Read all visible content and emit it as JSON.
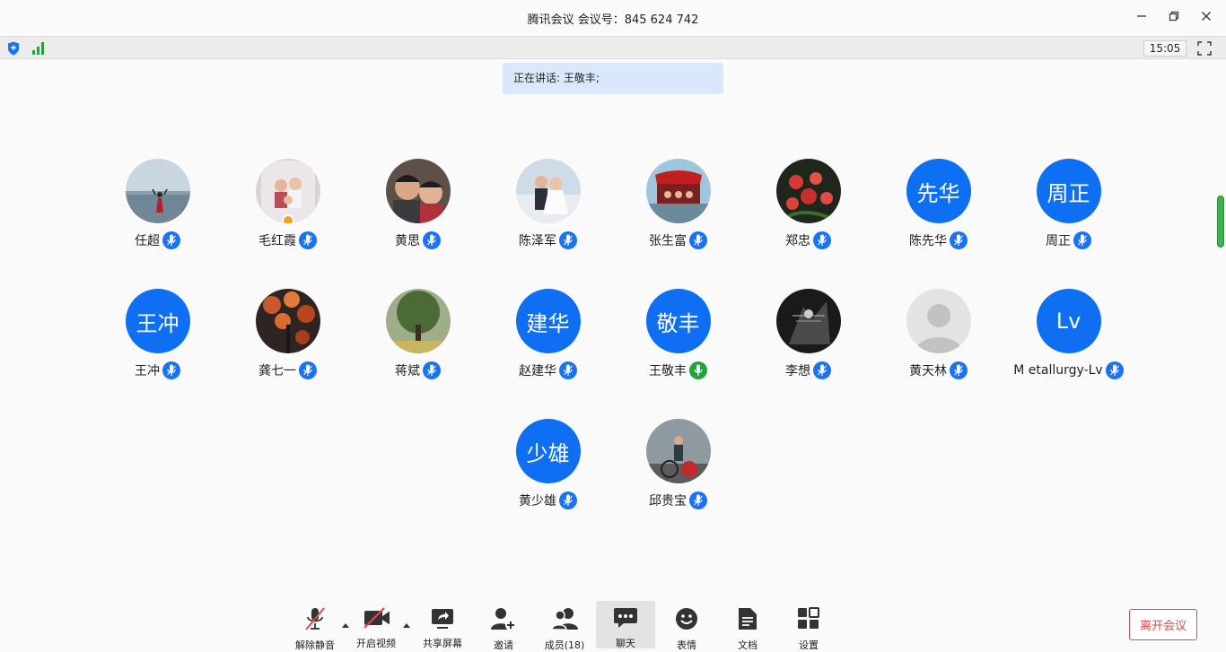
{
  "window": {
    "title": "腾讯会议 会议号：845 624 742"
  },
  "status": {
    "clock": "15:05"
  },
  "speaking_banner": "正在讲话: 王敬丰;",
  "members": [
    {
      "name": "任超",
      "avatar": "photo-seaside",
      "mic": "muted"
    },
    {
      "name": "毛红霞",
      "avatar": "photo-family",
      "mic": "muted",
      "host": true
    },
    {
      "name": "黄思",
      "avatar": "photo-selfie",
      "mic": "muted"
    },
    {
      "name": "陈泽军",
      "avatar": "photo-wedding",
      "mic": "muted"
    },
    {
      "name": "张生富",
      "avatar": "photo-boat",
      "mic": "muted"
    },
    {
      "name": "郑忠",
      "avatar": "photo-roses",
      "mic": "muted"
    },
    {
      "name": "陈先华",
      "initials": "先华",
      "mic": "muted"
    },
    {
      "name": "周正",
      "initials": "周正",
      "mic": "muted"
    },
    {
      "name": "王冲",
      "initials": "王冲",
      "mic": "muted"
    },
    {
      "name": "龚七一",
      "avatar": "photo-autumn",
      "mic": "muted"
    },
    {
      "name": "蒋斌",
      "avatar": "photo-tree",
      "mic": "muted"
    },
    {
      "name": "赵建华",
      "initials": "建华",
      "mic": "muted"
    },
    {
      "name": "王敬丰",
      "initials": "敬丰",
      "mic": "speaking"
    },
    {
      "name": "李想",
      "avatar": "photo-bw",
      "mic": "muted"
    },
    {
      "name": "黄天林",
      "avatar": "default-avatar",
      "mic": "muted"
    },
    {
      "name": "M etallurgy-Lv",
      "initials": "Lv",
      "mic": "muted"
    },
    {
      "name": "黄少雄",
      "initials": "少雄",
      "mic": "muted"
    },
    {
      "name": "邱贵宝",
      "avatar": "photo-bicycle",
      "mic": "muted"
    }
  ],
  "toolbar": {
    "unmute": "解除静音",
    "video": "开启视频",
    "share": "共享屏幕",
    "invite": "邀请",
    "members": "成员(18)",
    "chat": "聊天",
    "emoji": "表情",
    "docs": "文档",
    "settings": "设置",
    "leave": "离开会议"
  },
  "colors": {
    "accent": "#0e6ff3",
    "speaking": "#22a33c",
    "leave": "#e04848"
  }
}
